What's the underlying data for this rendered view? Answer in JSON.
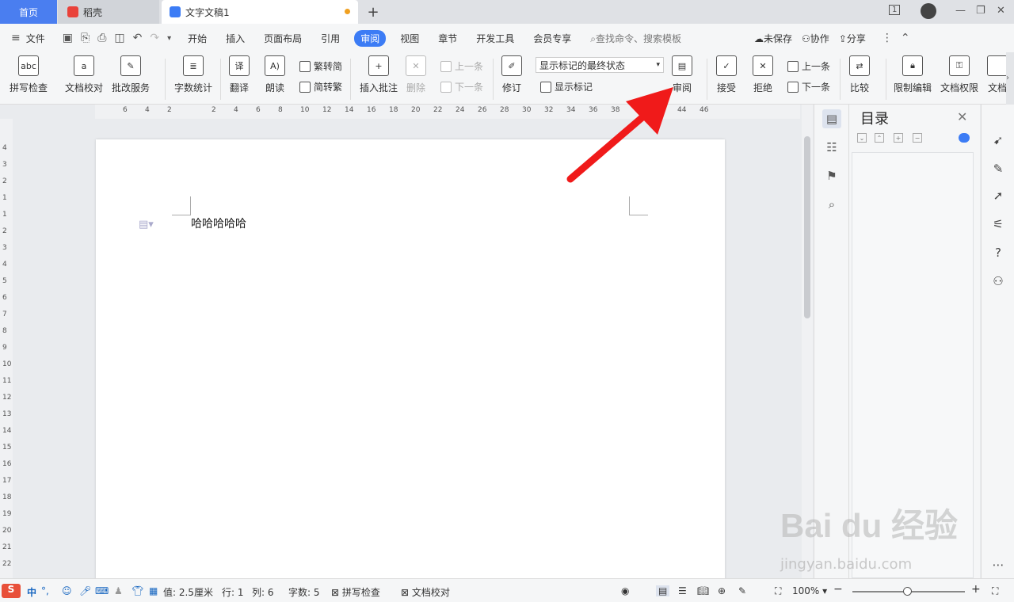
{
  "tabs": {
    "home": "首页",
    "daoke": "稻壳",
    "doc": "文字文稿1",
    "add": "+"
  },
  "window": {
    "page_badge": "1"
  },
  "menubar": {
    "file": "文件",
    "items": [
      "开始",
      "插入",
      "页面布局",
      "引用",
      "审阅",
      "视图",
      "章节",
      "开发工具",
      "会员专享"
    ],
    "active": "审阅",
    "search": "查找命令、搜索模板",
    "unsaved": "未保存",
    "collab": "协作",
    "share": "分享"
  },
  "ribbon": {
    "spell": "拼写检查",
    "proofread": "文档校对",
    "correct": "批改服务",
    "wordcount": "字数统计",
    "translate": "翻译",
    "read": "朗读",
    "trad2simp": "繁转简",
    "simp2trad": "简转繁",
    "insert_comment": "插入批注",
    "delete": "删除",
    "prev": "上一条",
    "next": "下一条",
    "track": "修订",
    "markup_state": "显示标记的最终状态",
    "show_markup": "显示标记",
    "review": "审阅",
    "accept": "接受",
    "reject": "拒绝",
    "prev2": "上一条",
    "next2": "下一条",
    "compare": "比较",
    "restrict": "限制编辑",
    "perm": "文档权限",
    "more": "文档"
  },
  "ruler": {
    "h": [
      "6",
      "4",
      "2",
      "2",
      "4",
      "6",
      "8",
      "10",
      "12",
      "14",
      "16",
      "18",
      "20",
      "22",
      "24",
      "26",
      "28",
      "30",
      "32",
      "34",
      "36",
      "38",
      "44",
      "46"
    ],
    "v": [
      "4",
      "3",
      "2",
      "1",
      "1",
      "2",
      "3",
      "4",
      "5",
      "6",
      "7",
      "8",
      "9",
      "10",
      "11",
      "12",
      "13",
      "14",
      "15",
      "16",
      "17",
      "18",
      "19",
      "20",
      "21",
      "22"
    ]
  },
  "document": {
    "text": "哈哈哈哈哈"
  },
  "toc": {
    "title": "目录"
  },
  "status": {
    "margin": "值: 2.5厘米",
    "row": "行: 1",
    "col": "列: 6",
    "words": "字数: 5",
    "spell": "拼写检查",
    "proof": "文档校对",
    "zoom": "100%"
  },
  "ime": {
    "cn": "中"
  },
  "watermark": {
    "brand": "Bai du 经验",
    "url": "jingyan.baidu.com"
  },
  "colors": {
    "accent": "#3c7cf5",
    "arrow": "#f01a1a"
  }
}
